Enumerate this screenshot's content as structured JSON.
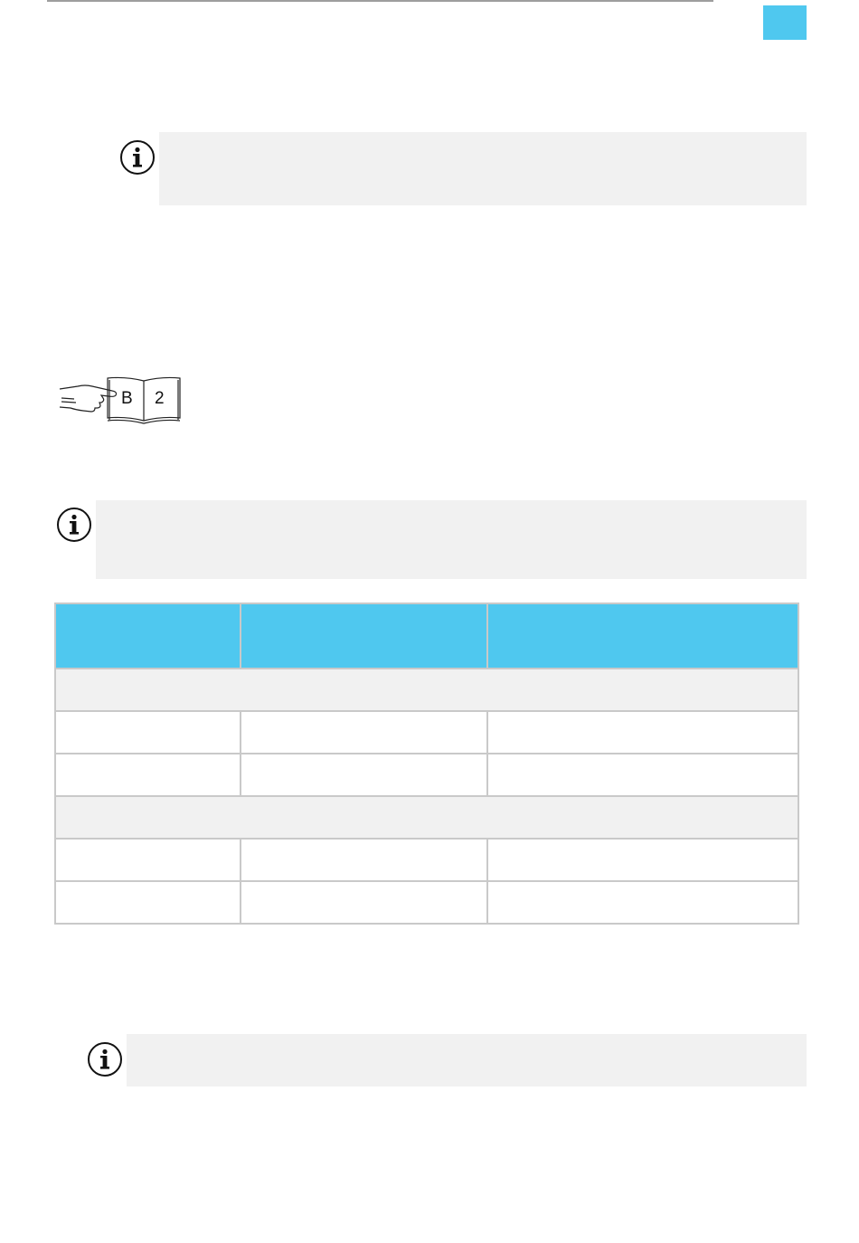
{
  "theme": {
    "accent": "#4fc8ef",
    "note_background": "#f1f1f1",
    "rule_color": "#9e9e9e"
  },
  "icons": {
    "info": "info-icon",
    "manual_reference": "manual-reference-icon"
  },
  "manual_reference": {
    "section_letter": "B",
    "section_number": "2"
  },
  "table": {
    "headers": [
      "",
      "",
      ""
    ],
    "groups": [
      {
        "label": "",
        "rows": [
          [
            "",
            "",
            ""
          ],
          [
            "",
            "",
            ""
          ]
        ]
      },
      {
        "label": "",
        "rows": [
          [
            "",
            "",
            ""
          ],
          [
            "",
            "",
            ""
          ]
        ]
      }
    ]
  }
}
